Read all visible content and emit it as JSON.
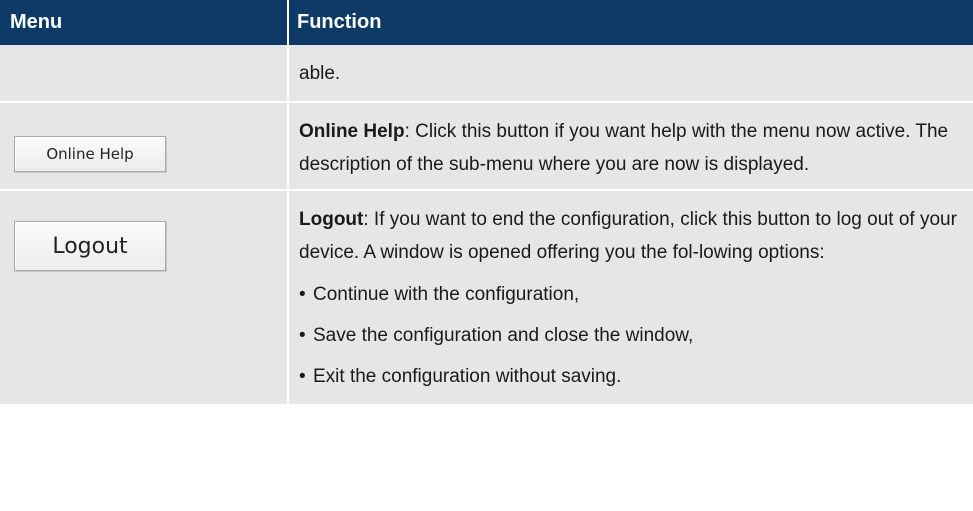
{
  "table": {
    "headers": {
      "menu": "Menu",
      "function": "Function"
    },
    "continued_row": {
      "function_text": "able."
    },
    "online_help_row": {
      "button_label": "Online Help",
      "term": "Online Help",
      "description": ": Click this button if you want help with the menu now active. The description of the sub-menu where you are now is displayed."
    },
    "logout_row": {
      "button_label": "Logout",
      "term": "Logout",
      "description": ": If you want to end the configuration, click this button to log out of your device. A window is opened offering you the fol-lowing options:",
      "options": [
        "Continue with the configuration,",
        "Save the configuration and close the window,",
        "Exit the configuration without saving."
      ]
    }
  },
  "colors": {
    "header_background": "#0d3a66",
    "row_background": "#e6e6e6"
  }
}
